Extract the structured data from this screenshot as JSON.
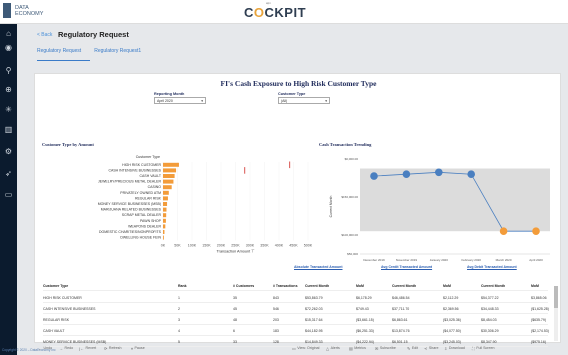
{
  "brand": {
    "line1": "DATA",
    "line2": "ECONOMY"
  },
  "logo": {
    "sub": "a|m",
    "pre": "C",
    "o": "O",
    "post": "CKPIT"
  },
  "sidebar": [
    {
      "name": "home-icon",
      "glyph": "⌂"
    },
    {
      "name": "view-icon",
      "glyph": "◉"
    },
    {
      "name": "search-icon",
      "glyph": "⚲"
    },
    {
      "name": "globe-icon",
      "glyph": "⊕"
    },
    {
      "name": "bug-icon",
      "glyph": "✳"
    },
    {
      "name": "chart-icon",
      "glyph": "▥"
    },
    {
      "name": "gear-icon",
      "glyph": "⚙"
    },
    {
      "name": "rocket-icon",
      "glyph": "➶"
    },
    {
      "name": "monitor-icon",
      "glyph": "▭"
    }
  ],
  "header": {
    "back": "< Back",
    "title": "Regulatory Request"
  },
  "tabs": [
    "Regulatory Request",
    "Regulatory Request1"
  ],
  "report": {
    "title": "FI's Cash Exposure to High Risk Customer Type",
    "filters": [
      {
        "label": "Reporting Month",
        "value": "April 2020"
      },
      {
        "label": "Customer Type",
        "value": "(All)"
      }
    ],
    "left_title": "Customer Type by Amount",
    "right_title": "Cash Transaction Trending"
  },
  "chart_data": [
    {
      "type": "bar",
      "title": "Customer Type by Amount",
      "xlabel": "Transaction Amount",
      "ylabel": "Customer Type",
      "categories": [
        "HIGH RISK CUSTOMER",
        "CASH INTENSIVE BUSINESSES",
        "CASH VAULT",
        "JEWELRY/PRECIOUS METAL DEALER",
        "CASINO",
        "PRIVATELY OWNED ATM",
        "REGULAR RISK",
        "MONEY SERVICE BUSINESSES (MSB)",
        "MARIJUANA RELATED BUSINESSES",
        "SCRAP METAL DEALER",
        "PAWN SHOP",
        "WEAPONS DEALER",
        "DOMESTIC CHARITIES/NONPROFITS",
        "DWELLING HOUSE FEIN"
      ],
      "values": [
        55000,
        45000,
        40000,
        36000,
        30000,
        20000,
        17000,
        14000,
        12000,
        11000,
        10000,
        8000,
        5000,
        3000
      ],
      "reference_markers": [
        [
          null,
          435000
        ],
        [
          280000,
          null
        ],
        [
          null,
          null
        ],
        [
          null,
          null
        ],
        [
          null,
          null
        ],
        [
          null,
          null
        ],
        [
          null,
          null
        ],
        [
          null,
          null
        ],
        [
          null,
          null
        ],
        [
          null,
          null
        ],
        [
          null,
          null
        ],
        [
          null,
          null
        ],
        [
          null,
          null
        ],
        [
          null,
          null
        ]
      ],
      "xticks": [
        "0K",
        "50K",
        "100K",
        "150K",
        "200K",
        "250K",
        "300K",
        "350K",
        "400K",
        "450K",
        "500K"
      ],
      "xlim": [
        0,
        500000
      ],
      "colors": {
        "bar": "#f39c3a",
        "marker": "#d9534f"
      }
    },
    {
      "type": "line",
      "title": "Cash Transaction Trending",
      "ylabel": "Current Month",
      "x": [
        "December 2019",
        "November 2019",
        "January 2020",
        "February 2020",
        "March 2020",
        "April 2020"
      ],
      "series": [
        {
          "values": [
            205000,
            210000,
            215000,
            210000,
            60000,
            60000
          ]
        }
      ],
      "point_colors": [
        "#4a7fc0",
        "#4a7fc0",
        "#4a7fc0",
        "#4a7fc0",
        "#f39c3a",
        "#f39c3a"
      ],
      "yticks": [
        "$50,000",
        "$100,000.00",
        "$150,000.00",
        "$0,000.00"
      ],
      "ylim": [
        0,
        250000
      ],
      "colors": {
        "band": "#dcdcdc",
        "line": "#4a7fc0"
      }
    }
  ],
  "table": {
    "group_headers": [
      "Absolute Transacted Amount",
      "Avg Credit Transacted Amount",
      "Avg Debit Transacted Amount"
    ],
    "columns": [
      "Customer Type",
      "Rank",
      "# Customers",
      "# Transactions",
      "Current Month",
      "MoM",
      "Current Month",
      "MoM",
      "Current Month",
      "MoM"
    ],
    "rows": [
      [
        "HIGH RISK CUSTOMER",
        "1",
        "35",
        "843",
        "$53,863.79",
        "$6,178.29",
        "$46,486.54",
        "$2,112.29",
        "$54,377.22",
        "$3,865.06"
      ],
      [
        "CASH INTENSIVE BUSINESSES",
        "2",
        "45",
        "546",
        "$72,262.03",
        "$749.43",
        "$37,711.70",
        "$2,369.56",
        "$34,448.33",
        "($1,625.28)"
      ],
      [
        "REGULAR RISK",
        "3",
        "48",
        "203",
        "$15,317.64",
        "($3,661.15)",
        "$6,863.61",
        "($3,025.36)",
        "$8,454.03",
        "($635.79)"
      ],
      [
        "CASH VAULT",
        "4",
        "6",
        "183",
        "$44,182.95",
        "($6,251.33)",
        "$13,874.76",
        "($4,077.50)",
        "$30,306.29",
        "($2,174.53)"
      ],
      [
        "MONEY SERVICE BUSINESSES (MSB)",
        "5",
        "33",
        "128",
        "$14,849.33",
        "($4,222.94)",
        "$6,501.15",
        "($3,245.03)",
        "$8,347.90",
        "($975.16)"
      ]
    ]
  },
  "toolbar": {
    "left": [
      {
        "icon": "←",
        "label": "Undo"
      },
      {
        "icon": "→",
        "label": "Redo"
      },
      {
        "icon": "|←",
        "label": "Revert"
      },
      {
        "icon": "⟳",
        "label": "Refresh"
      },
      {
        "icon": "⏸",
        "label": "Pause"
      }
    ],
    "right": [
      {
        "icon": "▭",
        "label": "View: Original"
      },
      {
        "icon": "△",
        "label": "Alerts"
      },
      {
        "icon": "▤",
        "label": "Metrics"
      },
      {
        "icon": "✉",
        "label": "Subscribe"
      },
      {
        "icon": "✎",
        "label": "Edit"
      },
      {
        "icon": "≺",
        "label": "Share"
      },
      {
        "icon": "⇩",
        "label": "Download"
      },
      {
        "icon": "⛶",
        "label": "Full Screen"
      }
    ]
  },
  "copyright": "Copyright © 2020 – DataEconomy Inc"
}
